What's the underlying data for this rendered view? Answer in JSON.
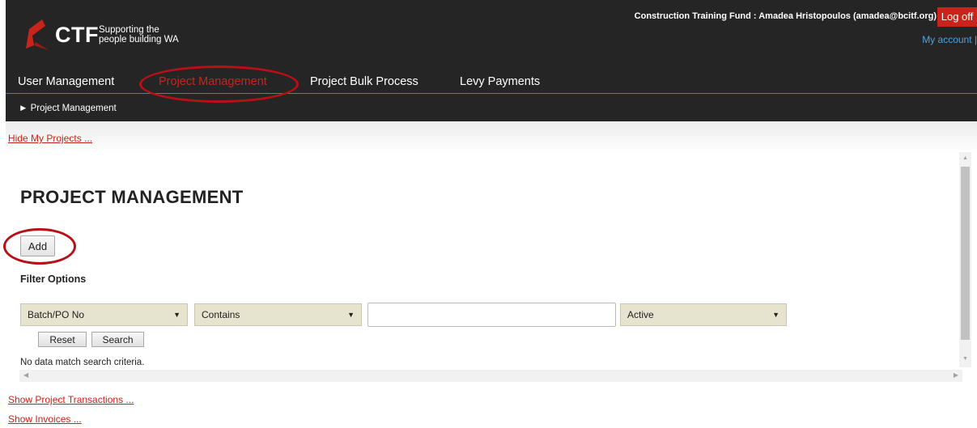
{
  "header": {
    "logo_text": "CTF",
    "logo_tagline_line1": "Supporting the",
    "logo_tagline_line2": "people building WA",
    "user_line": "Construction Training Fund : Amadea Hristopoulos (amadea@bcitf.org)",
    "logoff_label": "Log off",
    "my_account_label": "My account |"
  },
  "nav": {
    "items": [
      {
        "label": "User Management"
      },
      {
        "label": "Project Management",
        "active": true
      },
      {
        "label": "Project Bulk Process"
      },
      {
        "label": "Levy Payments"
      }
    ]
  },
  "breadcrumb": {
    "arrow": "►",
    "text": "Project Management"
  },
  "links": {
    "hide_my_projects": "Hide My Projects ...",
    "show_project_transactions": "Show Project Transactions ...",
    "show_invoices": "Show Invoices ..."
  },
  "main": {
    "title": "PROJECT MANAGEMENT",
    "add_label": "Add",
    "filter_label": "Filter Options",
    "filter_field": "Batch/PO No",
    "filter_operator": "Contains",
    "filter_value": "",
    "filter_status": "Active",
    "reset_label": "Reset",
    "search_label": "Search",
    "no_data": "No data match search criteria."
  },
  "icons": {
    "dropdown": "dropdown-caret-icon",
    "scroll_up": "scroll-up-arrow-icon",
    "scroll_down": "scroll-down-arrow-icon"
  },
  "colors": {
    "header_bg": "#252525",
    "brand_red": "#c8241b",
    "link_blue": "#4aa3df",
    "select_bg": "#e6e4cf",
    "annotation_ring": "#b71016"
  }
}
